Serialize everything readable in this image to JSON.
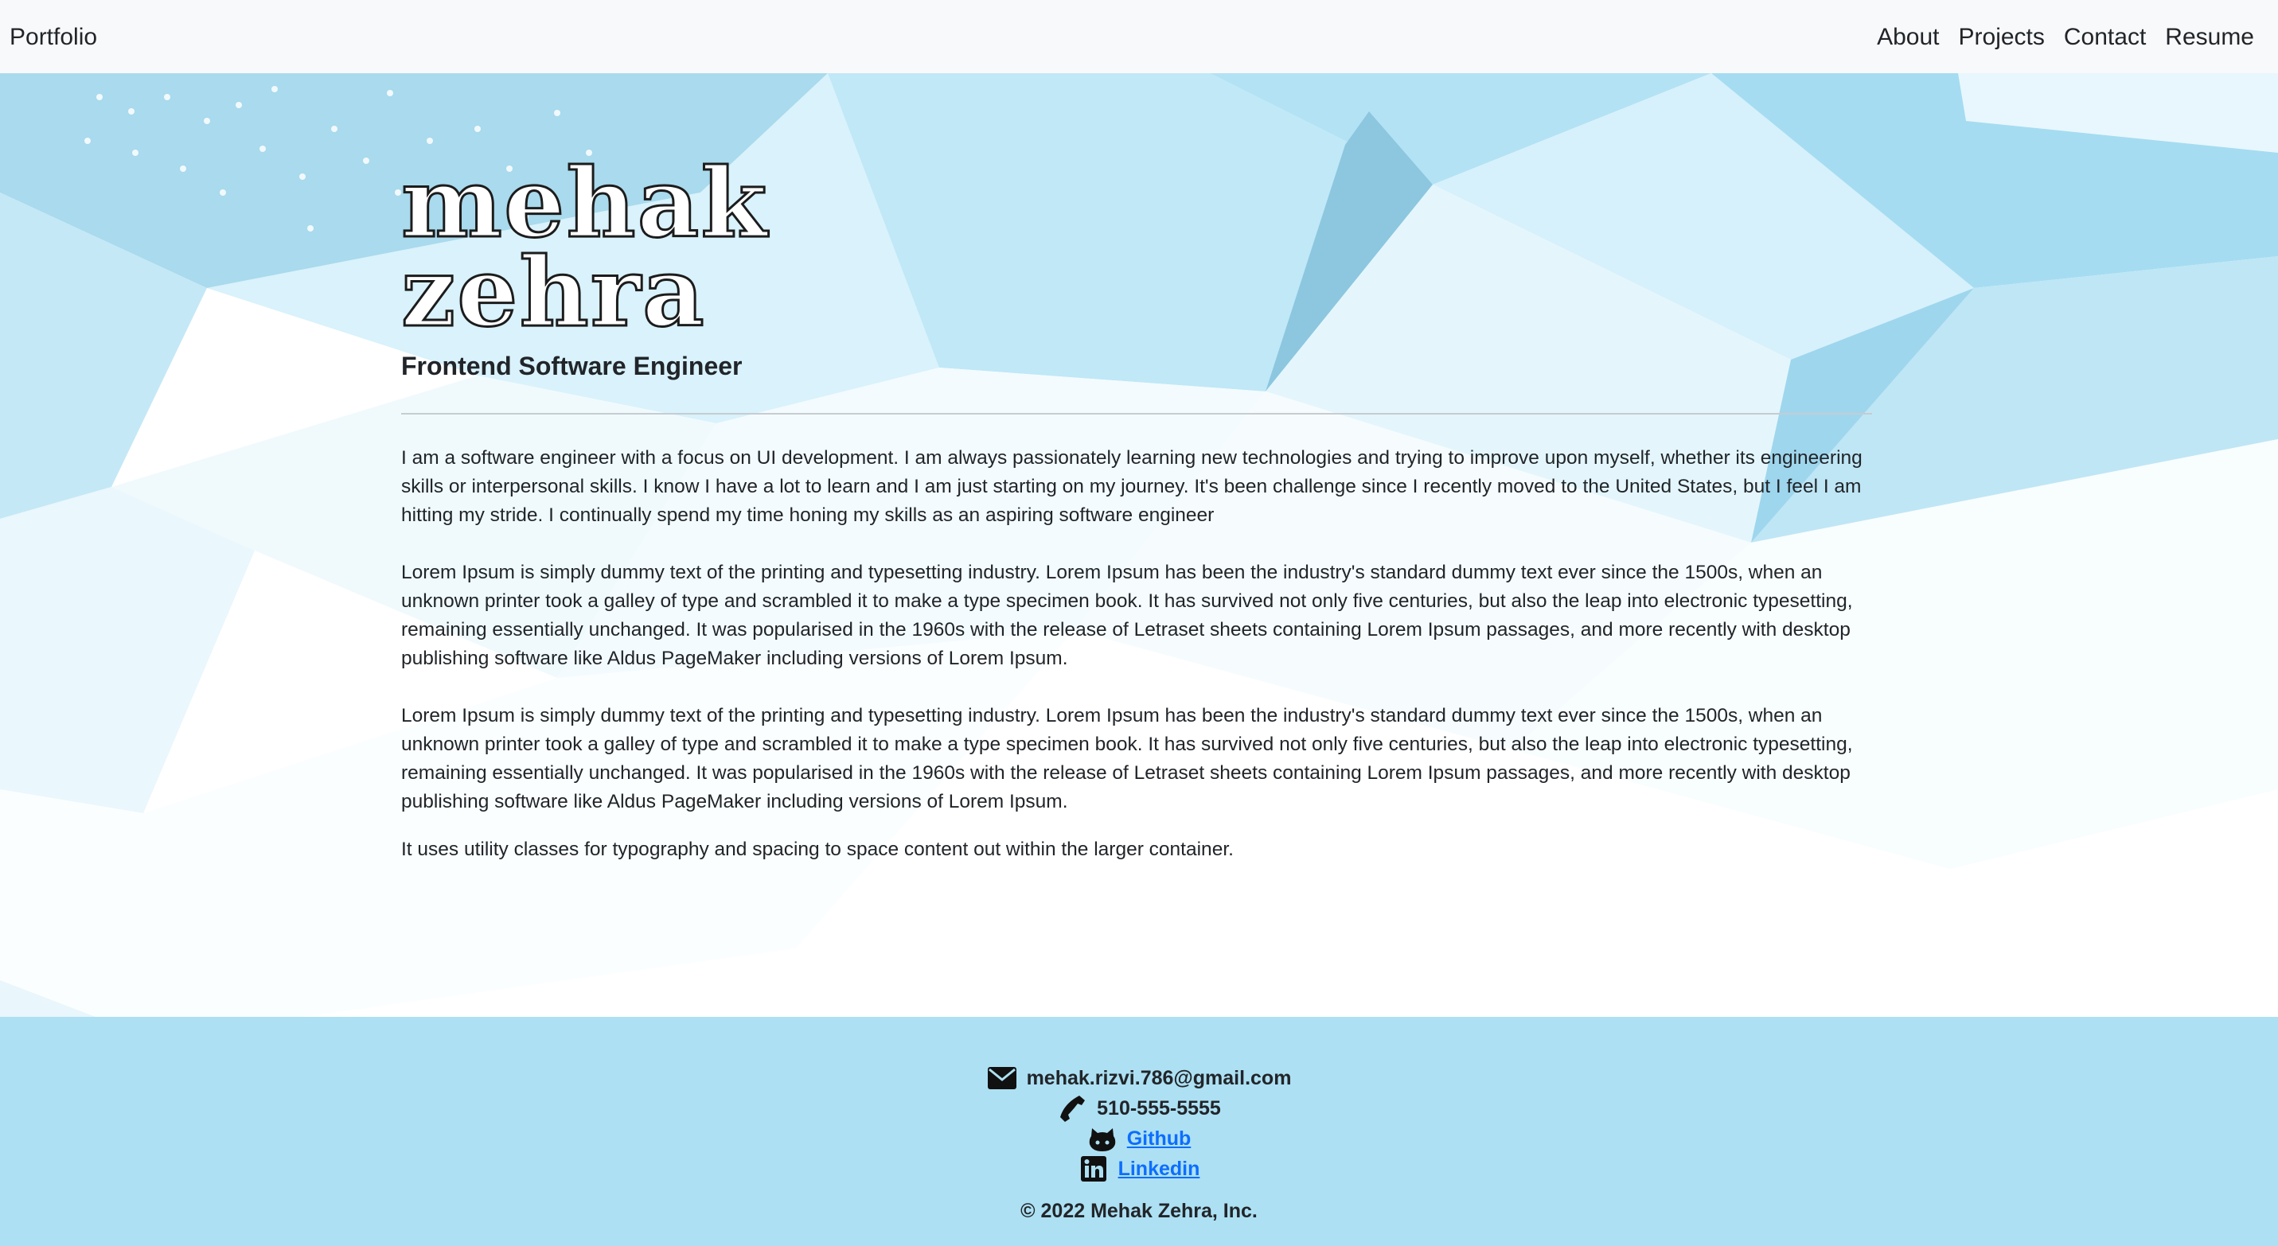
{
  "navbar": {
    "brand": "Portfolio",
    "links": [
      "About",
      "Projects",
      "Contact",
      "Resume"
    ]
  },
  "hero": {
    "name_line1": "mehak",
    "name_line2": "zehra",
    "subtitle": "Frontend Software Engineer",
    "paragraphs": [
      "I am a software engineer with a focus on UI development. I am always passionately learning new technologies and trying to improve upon myself, whether its engineering skills or interpersonal skills. I know I have a lot to learn and I am just starting on my journey. It's been challenge since I recently moved to the United States, but I feel I am hitting my stride. I continually spend my time honing my skills as an aspiring software engineer",
      "Lorem Ipsum is simply dummy text of the printing and typesetting industry. Lorem Ipsum has been the industry's standard dummy text ever since the 1500s, when an unknown printer took a galley of type and scrambled it to make a type specimen book. It has survived not only five centuries, but also the leap into electronic typesetting, remaining essentially unchanged. It was popularised in the 1960s with the release of Letraset sheets containing Lorem Ipsum passages, and more recently with desktop publishing software like Aldus PageMaker including versions of Lorem Ipsum.",
      "Lorem Ipsum is simply dummy text of the printing and typesetting industry. Lorem Ipsum has been the industry's standard dummy text ever since the 1500s, when an unknown printer took a galley of type and scrambled it to make a type specimen book. It has survived not only five centuries, but also the leap into electronic typesetting, remaining essentially unchanged. It was popularised in the 1960s with the release of Letraset sheets containing Lorem Ipsum passages, and more recently with desktop publishing software like Aldus PageMaker including versions of Lorem Ipsum.",
      "It uses utility classes for typography and spacing to space content out within the larger container."
    ]
  },
  "footer": {
    "email": "mehak.rizvi.786@gmail.com",
    "phone": "510-555-5555",
    "github": "Github",
    "linkedin": "Linkedin",
    "copyright": "© 2022 Mehak Zehra, Inc.",
    "icons": [
      "envelope-icon",
      "phone-icon",
      "github-icon",
      "linkedin-icon"
    ],
    "link_color": "#0d6efd",
    "background": "#ade0f3"
  },
  "colors": {
    "navbar_bg": "#f8f9fa",
    "accent_light_blue": "#ade0f3"
  }
}
